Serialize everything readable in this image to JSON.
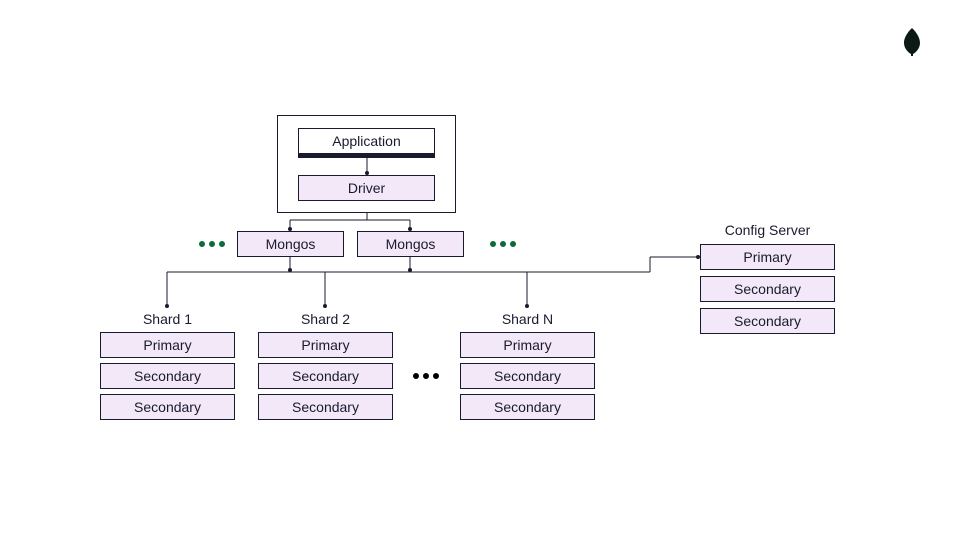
{
  "logo": {
    "name": "mongodb-leaf-icon",
    "fill": "#0b1a12"
  },
  "client": {
    "application_label": "Application",
    "driver_label": "Driver"
  },
  "routers": {
    "mongos_label": "Mongos",
    "count_shown": 2
  },
  "shards": [
    {
      "title": "Shard 1",
      "members": [
        "Primary",
        "Secondary",
        "Secondary"
      ]
    },
    {
      "title": "Shard 2",
      "members": [
        "Primary",
        "Secondary",
        "Secondary"
      ]
    },
    {
      "title": "Shard N",
      "members": [
        "Primary",
        "Secondary",
        "Secondary"
      ]
    }
  ],
  "config_server": {
    "title": "Config Server",
    "members": [
      "Primary",
      "Secondary",
      "Secondary"
    ]
  },
  "ellipsis": {
    "green": "•••",
    "black": "•••"
  },
  "colors": {
    "box_fill": "#f3e8f8",
    "stroke": "#1a1a2e",
    "green_dot": "#0b6b3a"
  }
}
